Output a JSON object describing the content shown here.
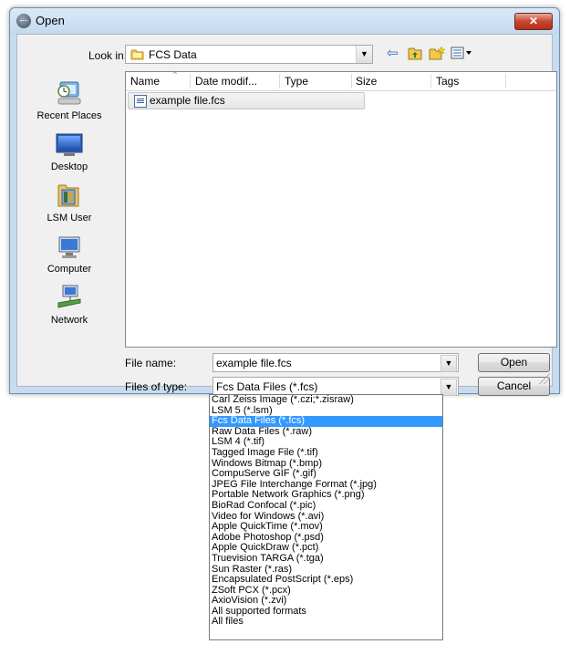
{
  "window": {
    "title": "Open",
    "close_glyph": "✕"
  },
  "toolbar": {
    "look_in_label": "Look in:",
    "look_in_value": "FCS Data",
    "back_icon": "⇦",
    "up_icon": "⇑",
    "new_folder_icon": "new-folder-icon",
    "views_icon": "views-icon"
  },
  "places": [
    {
      "label": "Recent Places",
      "icon": "recent-places-icon"
    },
    {
      "label": "Desktop",
      "icon": "desktop-icon"
    },
    {
      "label": "LSM User",
      "icon": "user-folder-icon"
    },
    {
      "label": "Computer",
      "icon": "computer-icon"
    },
    {
      "label": "Network",
      "icon": "network-icon"
    }
  ],
  "columns": [
    "Name",
    "Date modif...",
    "Type",
    "Size",
    "Tags"
  ],
  "files": [
    {
      "name": "example file.fcs"
    }
  ],
  "form": {
    "file_name_label": "File name:",
    "file_name_value": "example file.fcs",
    "file_type_label": "Files of type:",
    "file_type_value": "Fcs Data Files (*.fcs)"
  },
  "buttons": {
    "open": "Open",
    "cancel": "Cancel"
  },
  "file_type_options": [
    "Carl Zeiss Image (*.czi;*.zisraw)",
    "LSM 5 (*.lsm)",
    "Fcs Data Files (*.fcs)",
    "Raw Data Files (*.raw)",
    "LSM 4 (*.tif)",
    "Tagged Image File (*.tif)",
    "Windows Bitmap (*.bmp)",
    "CompuServe GIF (*.gif)",
    "JPEG File Interchange Format (*.jpg)",
    "Portable Network Graphics (*.png)",
    "BioRad Confocal (*.pic)",
    "Video for Windows (*.avi)",
    "Apple QuickTime (*.mov)",
    "Adobe Photoshop (*.psd)",
    "Apple QuickDraw (*.pct)",
    "Truevision TARGA (*.tga)",
    "Sun Raster (*.ras)",
    "Encapsulated PostScript (*.eps)",
    "ZSoft PCX (*.pcx)",
    "AxioVision (*.zvi)",
    "All supported formats",
    "All files"
  ],
  "selected_option_index": 2,
  "colors": {
    "selection": "#3399ff",
    "frame": "#c8dcf0",
    "close_button": "#c8452f"
  }
}
